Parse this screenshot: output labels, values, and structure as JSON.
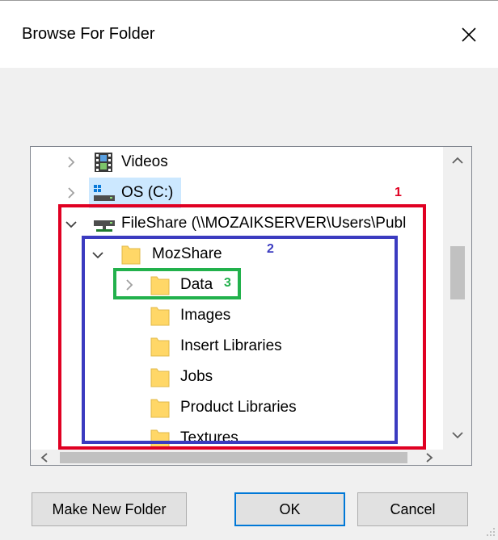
{
  "dialog": {
    "title": "Browse For Folder",
    "close_symbol": "✕"
  },
  "tree": {
    "items": [
      {
        "label": "Videos",
        "icon": "videos-icon",
        "expanded": false,
        "selected": false
      },
      {
        "label": "OS (C:)",
        "icon": "drive-icon",
        "expanded": false,
        "selected": true
      },
      {
        "label": "FileShare (\\\\MOZAIKSERVER\\Users\\Publ",
        "icon": "network-drive-icon",
        "expanded": true,
        "selected": false
      },
      {
        "label": "MozShare",
        "icon": "folder-icon",
        "expanded": true,
        "selected": false
      },
      {
        "label": "Data",
        "icon": "folder-icon",
        "expanded": false,
        "selected": false
      },
      {
        "label": "Images",
        "icon": "folder-icon",
        "selected": false
      },
      {
        "label": "Insert Libraries",
        "icon": "folder-icon",
        "selected": false
      },
      {
        "label": "Jobs",
        "icon": "folder-icon",
        "selected": false
      },
      {
        "label": "Product Libraries",
        "icon": "folder-icon",
        "selected": false
      },
      {
        "label": "Textures",
        "icon": "folder-icon",
        "selected": false
      }
    ]
  },
  "annotations": [
    {
      "number": "1",
      "color": "#e00022"
    },
    {
      "number": "2",
      "color": "#3b3bc0"
    },
    {
      "number": "3",
      "color": "#22b14c"
    }
  ],
  "buttons": {
    "make_new_folder": "Make New Folder",
    "ok": "OK",
    "cancel": "Cancel"
  },
  "colors": {
    "selection": "#cce8ff",
    "default_button_border": "#0078d7",
    "folder_fill": "#ffd767"
  }
}
